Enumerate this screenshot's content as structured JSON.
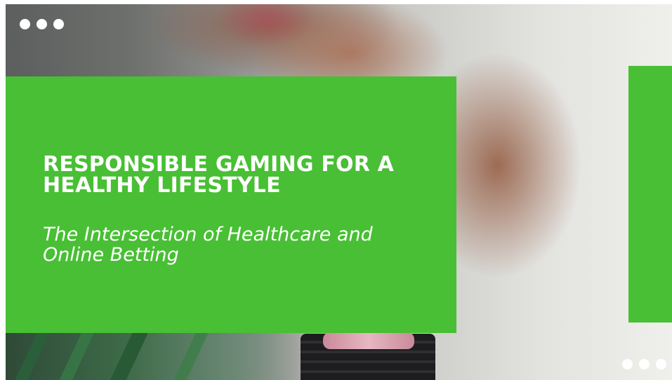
{
  "slide": {
    "title": "RESPONSIBLE GAMING FOR A HEALTHY LIFESTYLE",
    "subtitle": "The Intersection of Healthcare and Online Betting"
  },
  "colors": {
    "accent": "#48bf34",
    "text": "#ffffff"
  },
  "decorations": {
    "top_left_dots": 3,
    "bottom_right_dots": 3
  },
  "background_image": "photo-of-smiling-woman-with-shaker-bottle"
}
